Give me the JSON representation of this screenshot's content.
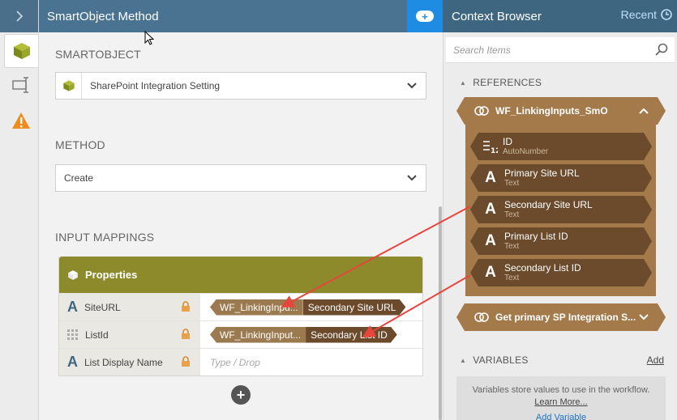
{
  "main": {
    "title": "SmartObject Method",
    "smartobject_label": "SMARTOBJECT",
    "smartobject_value": "SharePoint Integration Setting",
    "method_label": "METHOD",
    "method_value": "Create",
    "input_mappings_label": "INPUT MAPPINGS",
    "properties_header": "Properties",
    "rows": [
      {
        "name": "SiteURL",
        "icon": "text-A-icon",
        "token_source": "WF_LinkingInpu...",
        "token_field": "Secondary Site URL"
      },
      {
        "name": "ListId",
        "icon": "grid-icon",
        "token_source": "WF_LinkingInput...",
        "token_field": "Secondary List ID"
      },
      {
        "name": "List Display Name",
        "icon": "text-A-icon",
        "placeholder": "Type / Drop"
      }
    ]
  },
  "context": {
    "title": "Context Browser",
    "recent_label": "Recent",
    "search_placeholder": "Search Items",
    "references_label": "REFERENCES",
    "smartobject_ref": "WF_LinkingInputs_SmO",
    "properties": [
      {
        "name": "ID",
        "type": "AutoNumber",
        "icon": "autonumber-icon"
      },
      {
        "name": "Primary Site URL",
        "type": "Text",
        "icon": "text-A-icon"
      },
      {
        "name": "Secondary Site URL",
        "type": "Text",
        "icon": "text-A-icon"
      },
      {
        "name": "Primary List ID",
        "type": "Text",
        "icon": "text-A-icon"
      },
      {
        "name": "Secondary List ID",
        "type": "Text",
        "icon": "text-A-icon"
      }
    ],
    "second_ref": "Get primary SP Integration S...",
    "variables_label": "VARIABLES",
    "add_label": "Add",
    "variables_desc": "Variables store values to use in the workflow.",
    "learn_more": "Learn More...",
    "add_variable": "Add Variable"
  },
  "colors": {
    "accent_blue": "#1e8ce3",
    "header_blue": "#4a7391",
    "olive": "#8c8a2a",
    "brown_light": "#a47a4b",
    "brown_dark": "#6b4b2c",
    "warning_orange": "#f08c1e",
    "arrow_red": "#e8453c"
  }
}
